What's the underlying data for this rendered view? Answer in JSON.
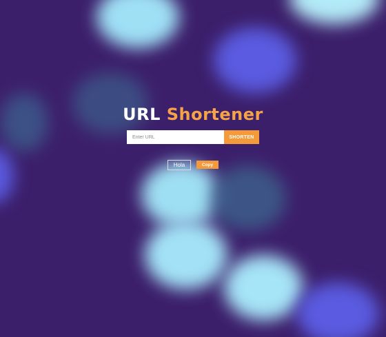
{
  "app": {
    "title_part1": "URL",
    "title_part2": "Shortener"
  },
  "form": {
    "url_input": {
      "placeholder": "Enter URL",
      "value": ""
    },
    "shorten_label": "SHORTEN"
  },
  "result": {
    "short_url": "Hola",
    "copy_label": "Copy"
  },
  "colors": {
    "background": "#3c1f6b",
    "accent": "#f49a3b",
    "title_highlight": "#f6a347"
  }
}
